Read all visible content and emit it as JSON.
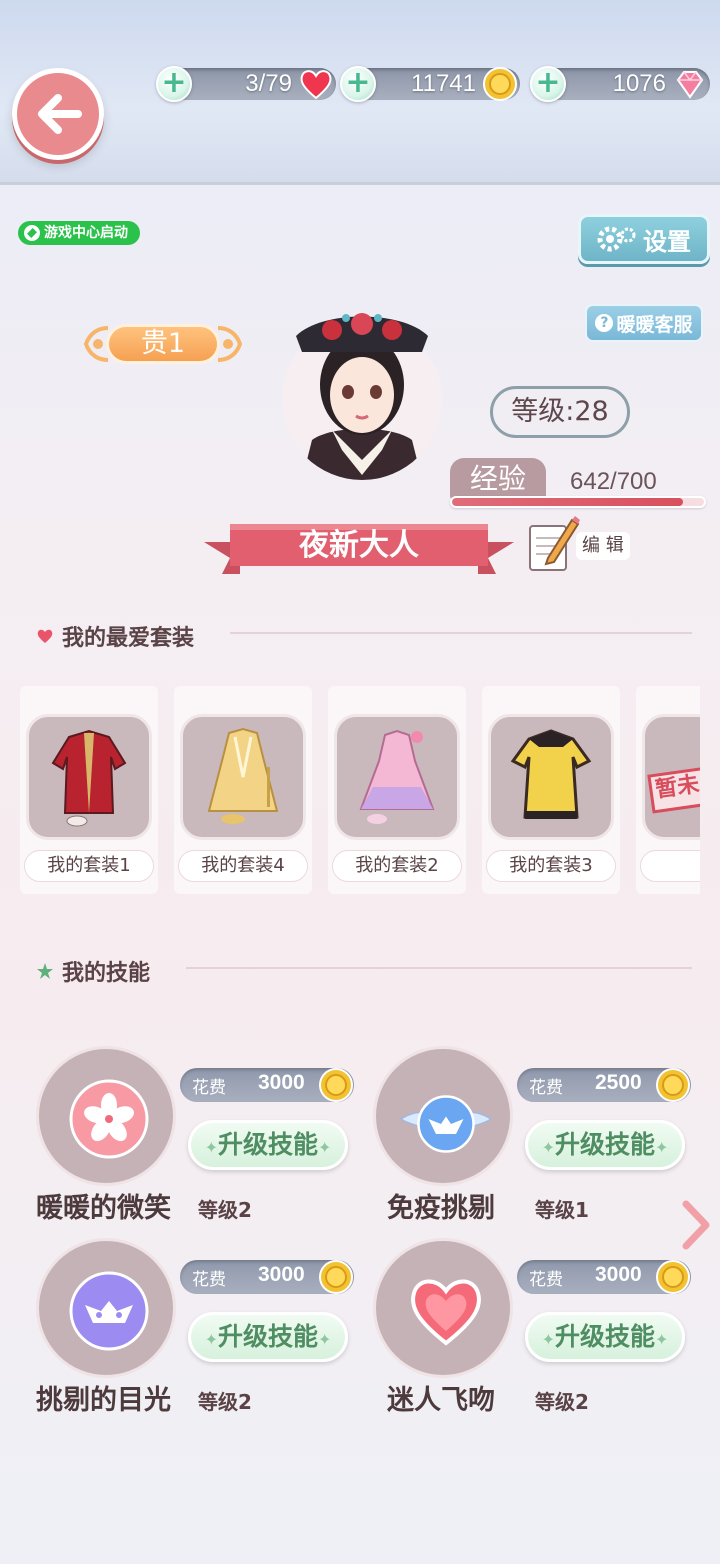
{
  "header": {
    "hearts": "3/79",
    "coins": "11741",
    "diamonds": "1076"
  },
  "game_center_label": "游戏中心启动",
  "settings_label": "设置",
  "service_label": "暖暖客服",
  "profile": {
    "rank": "贵1",
    "level_text": "等级:28",
    "exp_label": "经验",
    "exp_text": "642/700",
    "exp_fraction": 0.917,
    "name": "夜新大人",
    "edit_label": "编 辑"
  },
  "favorites": {
    "title": "我的最爱套装",
    "items": [
      {
        "name": "我的套装1",
        "icon": "red-robe-icon"
      },
      {
        "name": "我的套装4",
        "icon": "yellow-dress-icon"
      },
      {
        "name": "我的套装2",
        "icon": "pink-dress-icon"
      },
      {
        "name": "我的套装3",
        "icon": "yellow-gown-icon"
      },
      {
        "name": "",
        "partial_text": "暂未",
        "icon": "placeholder-icon"
      }
    ]
  },
  "skills": {
    "title": "我的技能",
    "cost_label": "花费",
    "upgrade_label": "升级技能",
    "items": [
      {
        "name": "暖暖的微笑",
        "level": "等级2",
        "cost": "3000",
        "icon": "sakura-icon"
      },
      {
        "name": "免疫挑剔",
        "level": "等级1",
        "cost": "2500",
        "icon": "winged-mask-icon"
      },
      {
        "name": "挑剔的目光",
        "level": "等级2",
        "cost": "3000",
        "icon": "purple-mask-icon"
      },
      {
        "name": "迷人飞吻",
        "level": "等级2",
        "cost": "3000",
        "icon": "heart-icon"
      }
    ]
  },
  "colors": {
    "accent_pink": "#e25f6f",
    "back_button": "#e98a8e",
    "rank_orange": "#f5a152",
    "upgrade_green": "#d6f1dc"
  }
}
